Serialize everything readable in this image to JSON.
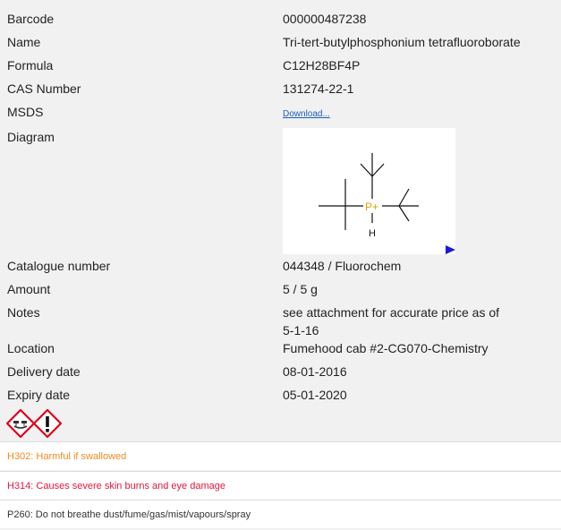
{
  "details": [
    {
      "label": "Barcode",
      "value": "000000487238"
    },
    {
      "label": "Name",
      "value": "Tri-tert-butylphosphonium tetrafluoroborate"
    },
    {
      "label": "Formula",
      "value": "C12H28BF4P"
    },
    {
      "label": "CAS Number",
      "value": "131274-22-1"
    },
    {
      "label": "MSDS",
      "value": "Download..."
    },
    {
      "label": "Diagram",
      "value": ""
    },
    {
      "label": "Catalogue number",
      "value": "044348 / Fluorochem"
    },
    {
      "label": "Amount",
      "value": "5 / 5 g"
    },
    {
      "label": "Notes",
      "value_line1": "see attachment for accurate price as of",
      "value_line2": "5-1-16"
    },
    {
      "label": "Location",
      "value": "Fumehood cab #2-CG070-Chemistry"
    },
    {
      "label": "Delivery date",
      "value": "08-01-2016"
    },
    {
      "label": "Expiry date",
      "value": "05-01-2020"
    }
  ],
  "diagram": {
    "atom_label": "P+",
    "h_label": "H",
    "atom_color": "#e0a000"
  },
  "hazard_pictograms": [
    "corrosion-icon",
    "exclamation-mark-icon"
  ],
  "statements": [
    {
      "text": "H302: Harmful if swallowed",
      "color": "#f08a24"
    },
    {
      "text": "H314: Causes severe skin burns and eye damage",
      "color": "#e0183c"
    },
    {
      "text": "P260: Do not breathe dust/fume/gas/mist/vapours/spray",
      "color": "#333333"
    }
  ],
  "colors": {
    "background": "#f1f1f1",
    "link": "#1a5fb4",
    "hazard_red": "#e0001a"
  }
}
